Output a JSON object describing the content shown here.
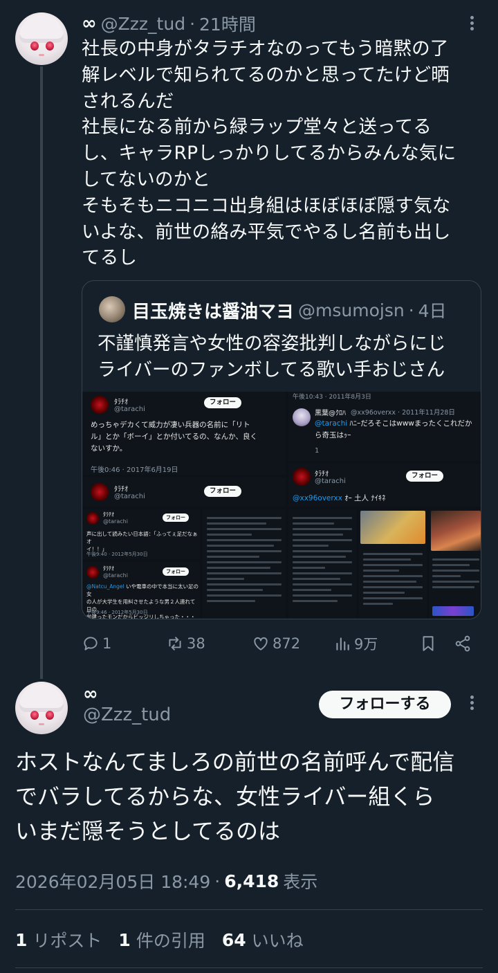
{
  "parent_tweet": {
    "display_name": "∞",
    "handle": "@Zzz_tud",
    "separator": "·",
    "time_ago": "21時間",
    "text": "社長の中身がタラチオなのってもう暗黙の了\n解レベルで知られてるのかと思ってたけど晒\nされるんだ\n社長になる前から緑ラップ堂々と送ってる\nし、キャラRPしっかりしてるからみんな気に\nしてないのかと\nそもそもニコニコ出身組はほぼほぼ隠す気な\nいよな、前世の絡み平気でやるし名前も出し\nてるし",
    "quote": {
      "display_name": "目玉焼きは醤油マヨ",
      "handle": "@msumojsn",
      "separator": "·",
      "time_ago": "4日",
      "text": "不謹慎発言や女性の容姿批判しながらにじ\nライバーのファンボしてる歌い手おじさん",
      "media": {
        "shot1": {
          "name": "ﾀﾗﾁｵ",
          "handle": "@tarachi",
          "follow": "フォロー",
          "text": "めっちゃデカくて威力が凄い兵器の名前に「リト\nル」とか「ボーイ」とか付いてるの、なんか、良く\nないすか。",
          "time": "午後0:46 · 2017年6月19日"
        },
        "shot2": {
          "name": "ﾀﾗﾁｵ",
          "handle": "@tarachi",
          "follow": "フォロー"
        },
        "shot3": {
          "name": "ﾀﾗﾁｵ",
          "handle": "@tarachi",
          "follow": "フォロー",
          "text": "声に出して読みたい日本語：「ふってぇ足だなぁオ\nイ！！」",
          "time": "午後9:40 · 2012年5月30日"
        },
        "shot4": {
          "name": "ﾀﾗﾁｵ",
          "handle": "@tarachi",
          "follow": "フォロー",
          "mention": "@Natcu_Angel",
          "text": " いや電車の中で本当に太い足の女\nの人が大学生を用糾させたような男２人連れて日の\n前建ったモンだからビッジリしちゃった・・・",
          "time": "午後9:46 · 2012年5月30日"
        },
        "shot5": {
          "header_time": "午後10:43 · 2011年8月3日",
          "name": "黒葉@ｸﾛﾊ",
          "handle": "@xx96overxx · 2011年11月28日",
          "mention": "@tarachi",
          "text": " ﾊﾆｰだろそこはwwwまったくこれだか\nら奇玉はｯｰ",
          "reply_count": "1"
        },
        "shot6": {
          "name": "ﾀﾗﾁｵ",
          "handle": "@tarachi",
          "follow": "フォロー",
          "mention": "@xx96overxx",
          "text": " ｵｰ 土人 ﾅｲｷﾈ"
        }
      }
    },
    "actions": {
      "replies": "1",
      "reposts": "38",
      "likes": "872",
      "views": "9万"
    }
  },
  "main_tweet": {
    "display_name": "∞",
    "handle": "@Zzz_tud",
    "follow_label": "フォローする",
    "text": "ホストなんてましろの前世の名前呼んで配信\nでバラしてるからな、女性ライバー組くら\nいまだ隠そうとしてるのは",
    "timestamp": "2026年02月05日 18:49",
    "separator": "·",
    "views_count": "6,418",
    "views_label": "表示",
    "stats": {
      "reposts_count": "1",
      "reposts_label": "リポスト",
      "quotes_count": "1",
      "quotes_label": "件の引用",
      "likes_count": "64",
      "likes_label": "いいね"
    }
  },
  "colors": {
    "background": "#15202b",
    "text_primary": "#f7f9f9",
    "text_secondary": "#8b98a5",
    "border": "#38444d",
    "link": "#1d9bf0"
  }
}
